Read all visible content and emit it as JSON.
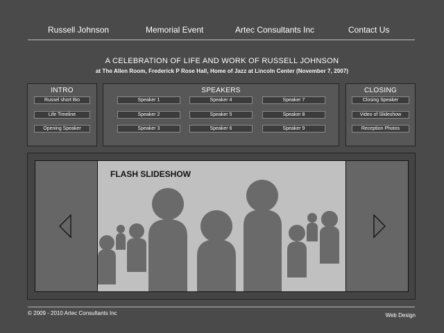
{
  "nav": {
    "items": [
      "Russell Johnson",
      "Memorial Event",
      "Artec Consultants Inc",
      "Contact Us"
    ]
  },
  "header": {
    "title": "A CELEBRATION OF LIFE AND WORK OF RUSSELL JOHNSON",
    "subtitle": "at The Allen Room, Frederick P Rose Hall, Home of Jazz at Lincoln Center (November 7, 2007)"
  },
  "intro": {
    "heading": "INTRO",
    "buttons": [
      "Russel short Bio",
      "Life Timeline",
      "Opening Speaker"
    ]
  },
  "speakers": {
    "heading": "SPEAKERS",
    "buttons": [
      "Speaker 1",
      "Speaker 2",
      "Speaker 3",
      "Speaker 4",
      "Speaker 5",
      "Speaker 6",
      "Speaker 7",
      "Speaker 8",
      "Speaker 9"
    ]
  },
  "closing": {
    "heading": "CLOSING",
    "buttons": [
      "Closing Speaker",
      "Video of Slideshow",
      "Reception Photos"
    ]
  },
  "slideshow": {
    "label": "FLASH SLIDESHOW",
    "icons": {
      "prev": "arrow-left-icon",
      "next": "arrow-right-icon",
      "people": "person-silhouette-icon"
    },
    "colors": {
      "background": "#c0c0c0",
      "figures": "#6a6a6a"
    }
  },
  "footer": {
    "copyright": "© 2009 - 2010 Artec Consultants Inc",
    "credit": "Web Design"
  },
  "colors": {
    "page": "#4a4a4a",
    "panel": "#575757",
    "button": "#3b3b3b"
  }
}
